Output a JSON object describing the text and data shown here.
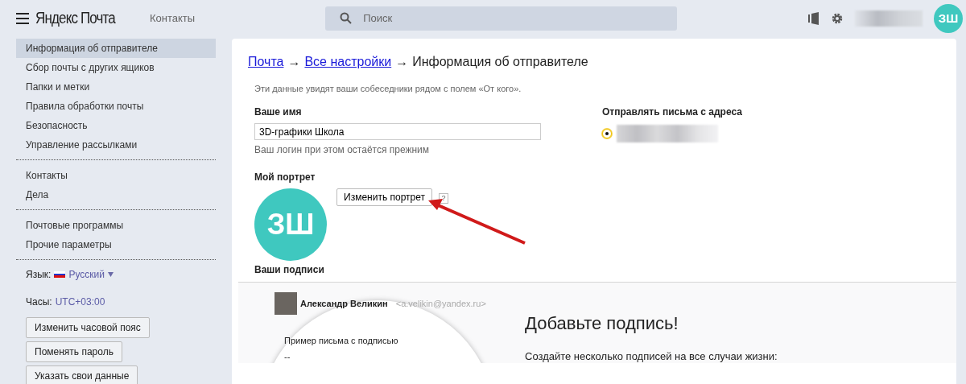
{
  "header": {
    "logo": "Яндекс Почта",
    "contacts_link": "Контакты",
    "search": {
      "placeholder": "Поиск"
    },
    "avatar": "ЗШ"
  },
  "sidebar": {
    "groups": [
      {
        "items": [
          {
            "label": "Информация об отправителе",
            "selected": true
          },
          {
            "label": "Сбор почты с других ящиков",
            "selected": false
          },
          {
            "label": "Папки и метки",
            "selected": false
          },
          {
            "label": "Правила обработки почты",
            "selected": false
          },
          {
            "label": "Безопасность",
            "selected": false
          },
          {
            "label": "Управление рассылками",
            "selected": false
          }
        ]
      },
      {
        "items": [
          {
            "label": "Контакты",
            "selected": false
          },
          {
            "label": "Дела",
            "selected": false
          }
        ]
      },
      {
        "items": [
          {
            "label": "Почтовые программы",
            "selected": false
          },
          {
            "label": "Прочие параметры",
            "selected": false
          }
        ]
      }
    ],
    "language": {
      "label": "Язык:",
      "value": "Русский"
    },
    "clock": {
      "label": "Часы:",
      "value": "UTC+03:00"
    },
    "buttons": [
      "Изменить часовой пояс",
      "Поменять пароль",
      "Указать свои данные"
    ]
  },
  "main": {
    "breadcrumb": {
      "links": [
        "Почта",
        "Все настройки"
      ],
      "separator": "→",
      "current": "Информация об отправителе"
    },
    "intro": "Эти данные увидят ваши собеседники рядом с полем «От кого».",
    "name": {
      "label": "Ваше имя",
      "value": "3D-графики Школа",
      "hint": "Ваш логин при этом остаётся прежним"
    },
    "sender": {
      "label": "Отправлять письма с адреса",
      "addresses": [
        {
          "selected": true
        }
      ]
    },
    "portrait": {
      "label": "Мой портрет",
      "initials": "ЗШ",
      "button": "Изменить портрет",
      "help": "?"
    },
    "signatures": {
      "heading": "Ваши подписи",
      "preview": {
        "author": "Александр Великин",
        "email": "<a.velikin@yandex.ru>",
        "sample": "Пример письма с подписью",
        "dash": "--"
      },
      "promo_title": "Добавьте подпись!",
      "promo_text": "Создайте несколько подписей на все случаи жизни:"
    }
  }
}
